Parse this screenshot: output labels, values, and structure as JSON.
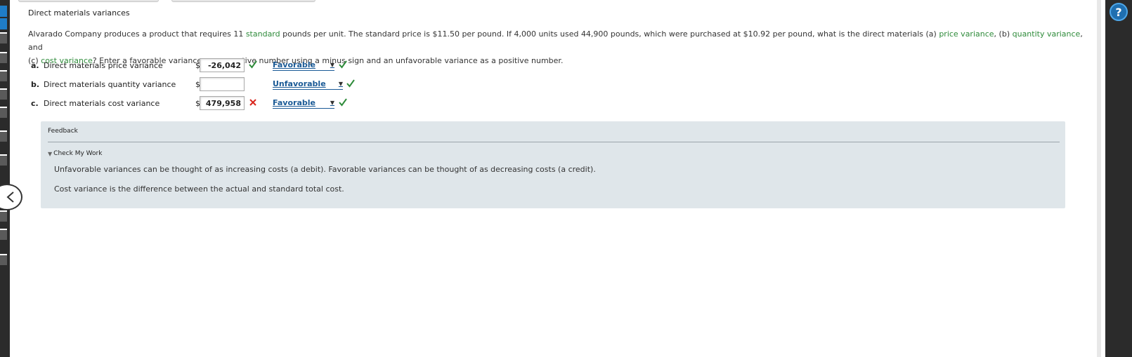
{
  "section_title": "Direct materials variances",
  "question": {
    "p1": "Alvarado Company produces a product that requires 11 ",
    "term_standard": "standard",
    "p2": " pounds per unit. The standard price is $11.50 per pound. If 4,000 units used 44,900 pounds, which were purchased at $10.92 per pound, what is the direct materials (a) ",
    "term_price": "price variance",
    "p3": ", (b) ",
    "term_quantity": "quantity variance",
    "p4": ", and",
    "p5": "(c) ",
    "term_cost": "cost variance",
    "p6": "? Enter a favorable variance as a negative number using a minus sign and an unfavorable variance as a positive number."
  },
  "rows": [
    {
      "letter": "a.",
      "label": "Direct materials price variance",
      "currency": "$",
      "amount": "-26,042",
      "amount_status": "correct",
      "selection": "Favorable",
      "selection_status": "correct"
    },
    {
      "letter": "b.",
      "label": "Direct materials quantity variance",
      "currency": "$",
      "amount": "",
      "amount_status": "none",
      "selection": "Unfavorable",
      "selection_status": "correct"
    },
    {
      "letter": "c.",
      "label": "Direct materials cost variance",
      "currency": "$",
      "amount": "479,958",
      "amount_status": "incorrect",
      "selection": "Favorable",
      "selection_status": "correct"
    }
  ],
  "feedback": {
    "title": "Feedback",
    "toggle_label": "Check My Work",
    "lines": [
      "Unfavorable variances can be thought of as increasing costs (a debit). Favorable variances can be thought of as decreasing costs (a credit).",
      "Cost variance is the difference between the actual and standard total cost."
    ]
  },
  "help_label": "?",
  "colors": {
    "term": "#2e8b3a",
    "correct": "#2e8b3a",
    "incorrect": "#d9251c",
    "link": "#1a5a96",
    "feedback_bg": "#dfe6ea",
    "rail": "#2b2b2b"
  },
  "icons": {
    "correct": "check-icon",
    "incorrect": "x-icon",
    "collapse": "chevron-left-icon",
    "help": "question-icon"
  }
}
